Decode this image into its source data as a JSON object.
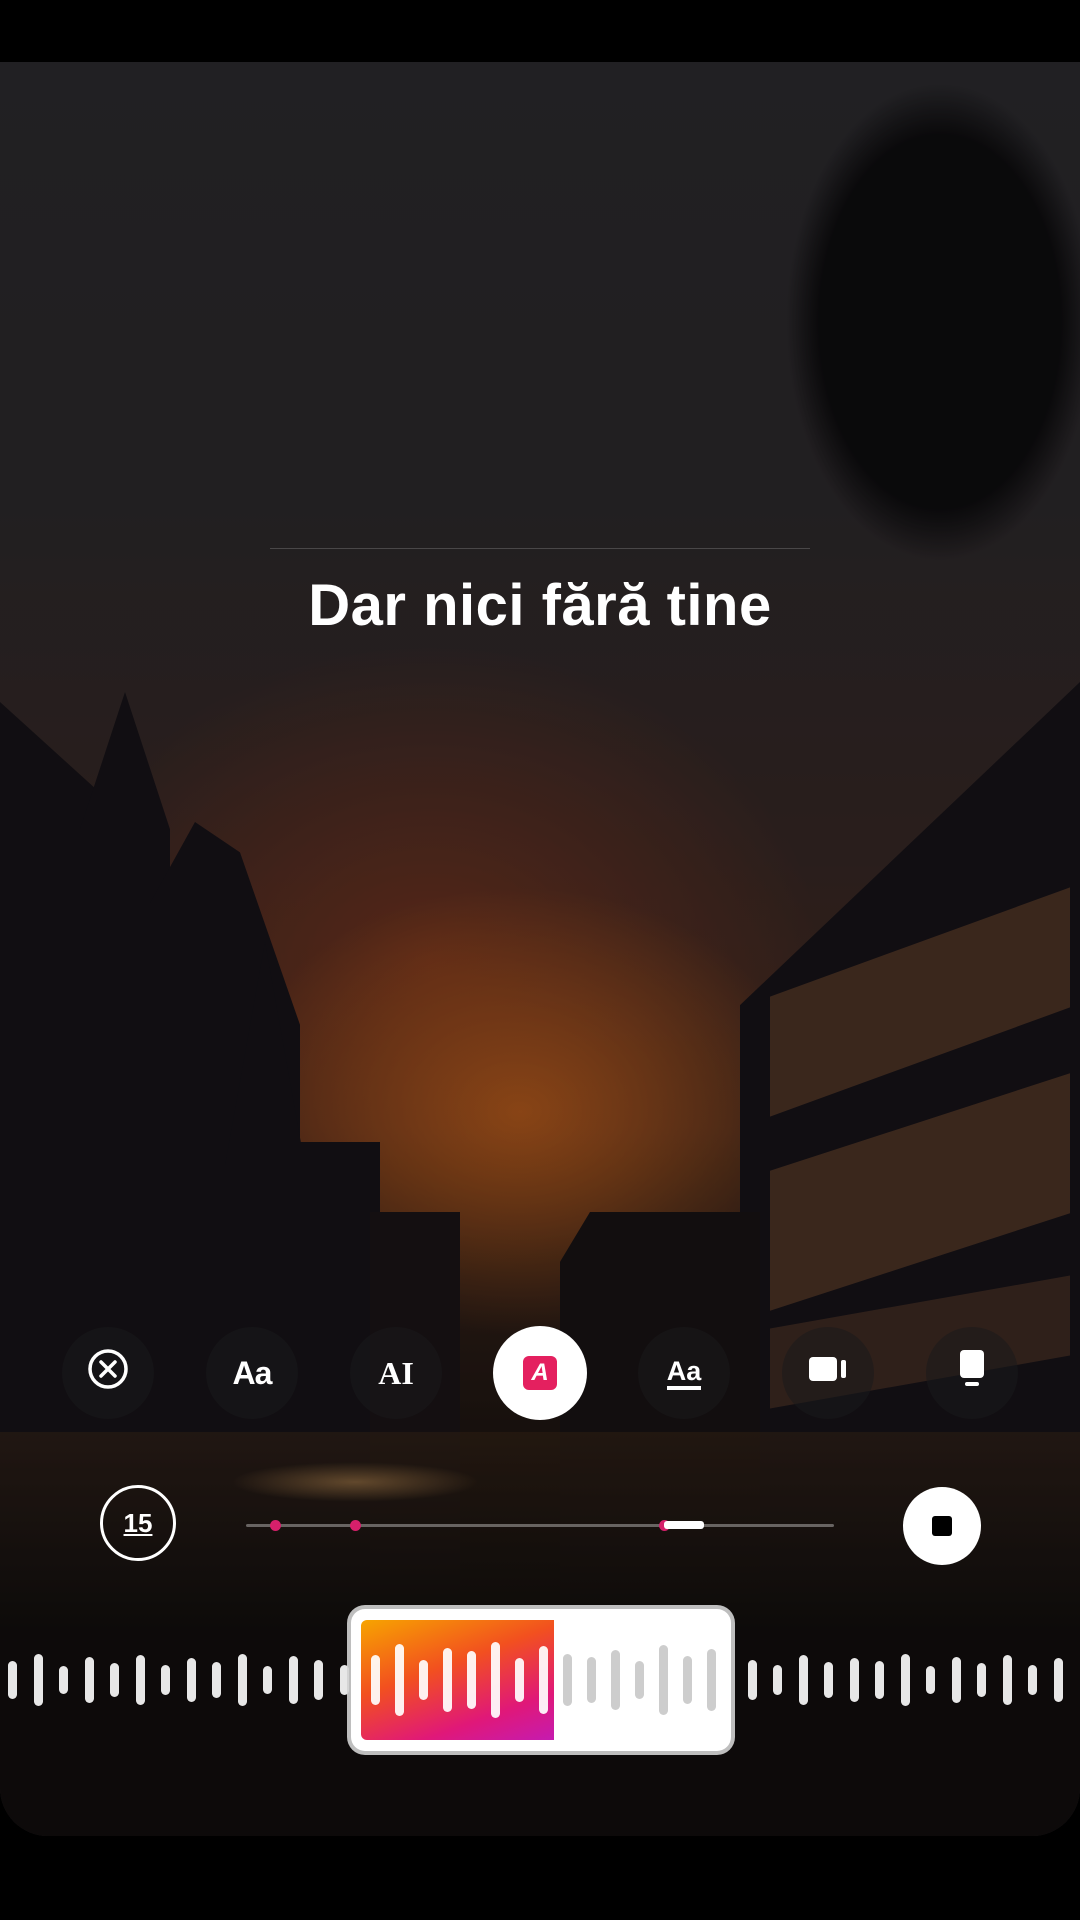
{
  "lyric": {
    "text": "Dar nici fără tine"
  },
  "toolbar": {
    "items": [
      {
        "name": "close",
        "icon": "close-circle-icon"
      },
      {
        "name": "style-aa-caps",
        "label": "Aa",
        "icon": "text-style-icon"
      },
      {
        "name": "style-ai",
        "label": "AI",
        "icon": "text-cursor-icon"
      },
      {
        "name": "style-highlight",
        "label": "A",
        "icon": "highlight-text-icon",
        "active": true
      },
      {
        "name": "style-underline",
        "label": "Aa",
        "icon": "underline-text-icon"
      },
      {
        "name": "layout-video",
        "icon": "video-card-icon"
      },
      {
        "name": "layout-phone",
        "icon": "phone-card-icon"
      }
    ]
  },
  "playback": {
    "duration_label": "15",
    "progress": 0.72,
    "stop_icon": "stop-icon"
  },
  "waveform": {
    "selection_progress": 0.5
  },
  "colors": {
    "accent_pink": "#e4205f",
    "gradient": [
      "#f7a400",
      "#f2501f",
      "#e01878",
      "#c51bb0"
    ]
  }
}
